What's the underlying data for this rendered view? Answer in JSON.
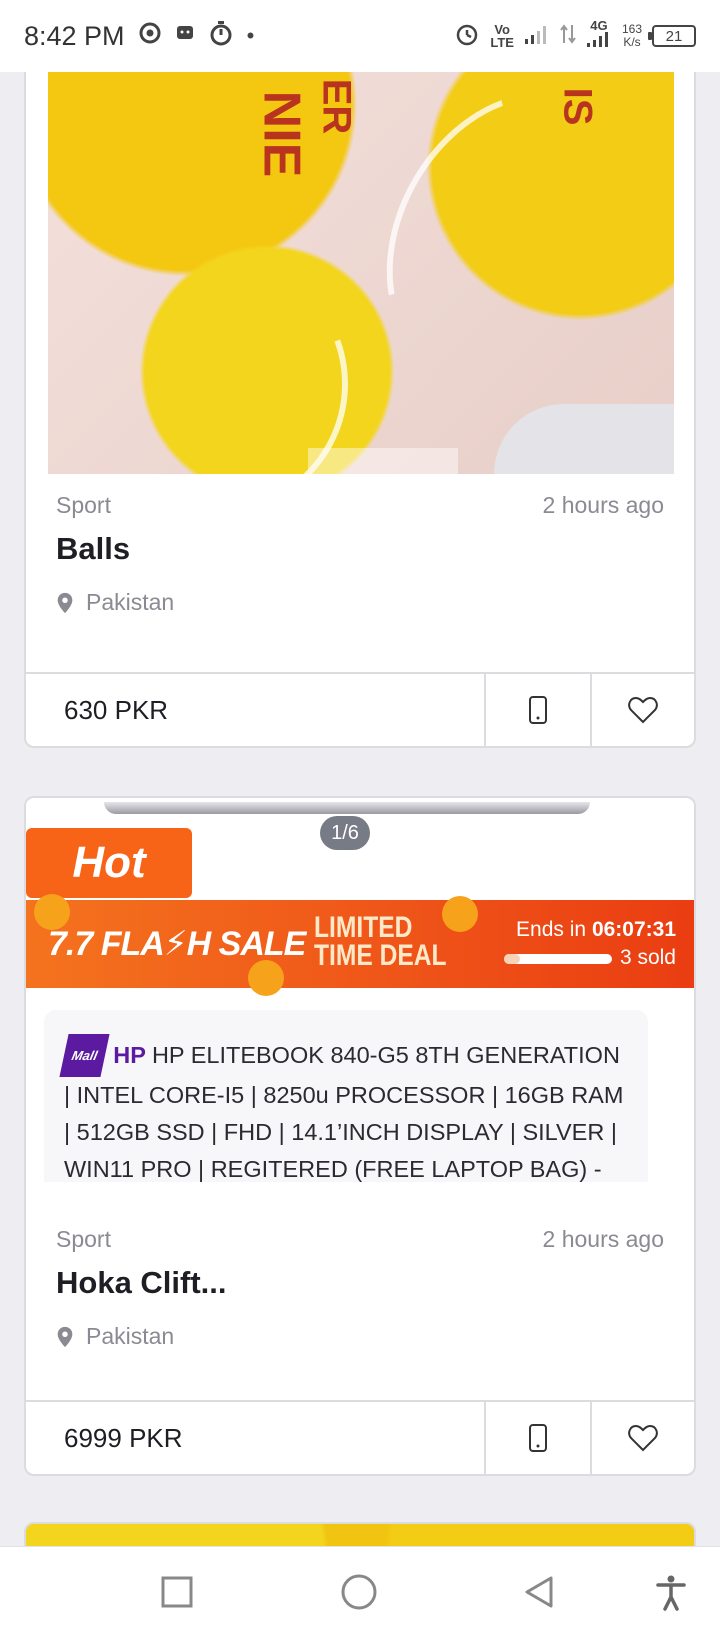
{
  "status": {
    "time": "8:42 PM",
    "network_top": "Vo",
    "network_bottom": "LTE",
    "net_type": "4G",
    "speed_value": "163",
    "speed_unit": "K/s",
    "battery": "21"
  },
  "listings": [
    {
      "category": "Sport",
      "posted": "2 hours ago",
      "title": "Balls",
      "location": "Pakistan",
      "price": "630 PKR"
    },
    {
      "image_counter": "1/6",
      "hot_label": "Hot",
      "flash_title": "7.7 FLA⚡H SALE",
      "flash_limited_1": "LIMITED",
      "flash_limited_2": "TIME DEAL",
      "ends_label": "Ends in",
      "ends_time": "06:07:31",
      "sold": "3 sold",
      "sold_fraction": 0.15,
      "mall_badge": "Mall",
      "brand": "HP",
      "product_text": "HP ELITEBOOK 840-G5 8TH GENERATION | INTEL CORE-I5 | 8250u PROCESSOR | 16GB RAM | 512GB SSD | FHD | 14.1’INCH DISPLAY | SILVER | WIN11 PRO | REGITERED (FREE LAPTOP BAG) -",
      "category": "Sport",
      "posted": "2 hours ago",
      "title": "Hoka Clift...",
      "location": "Pakistan",
      "price": "6999 PKR"
    }
  ],
  "image_text": {
    "ball_text_1": "NIE",
    "ball_text_2": "ER",
    "ball_text_3": "IS"
  },
  "colors": {
    "accent": "#f76418",
    "mall": "#5b1aa0"
  }
}
